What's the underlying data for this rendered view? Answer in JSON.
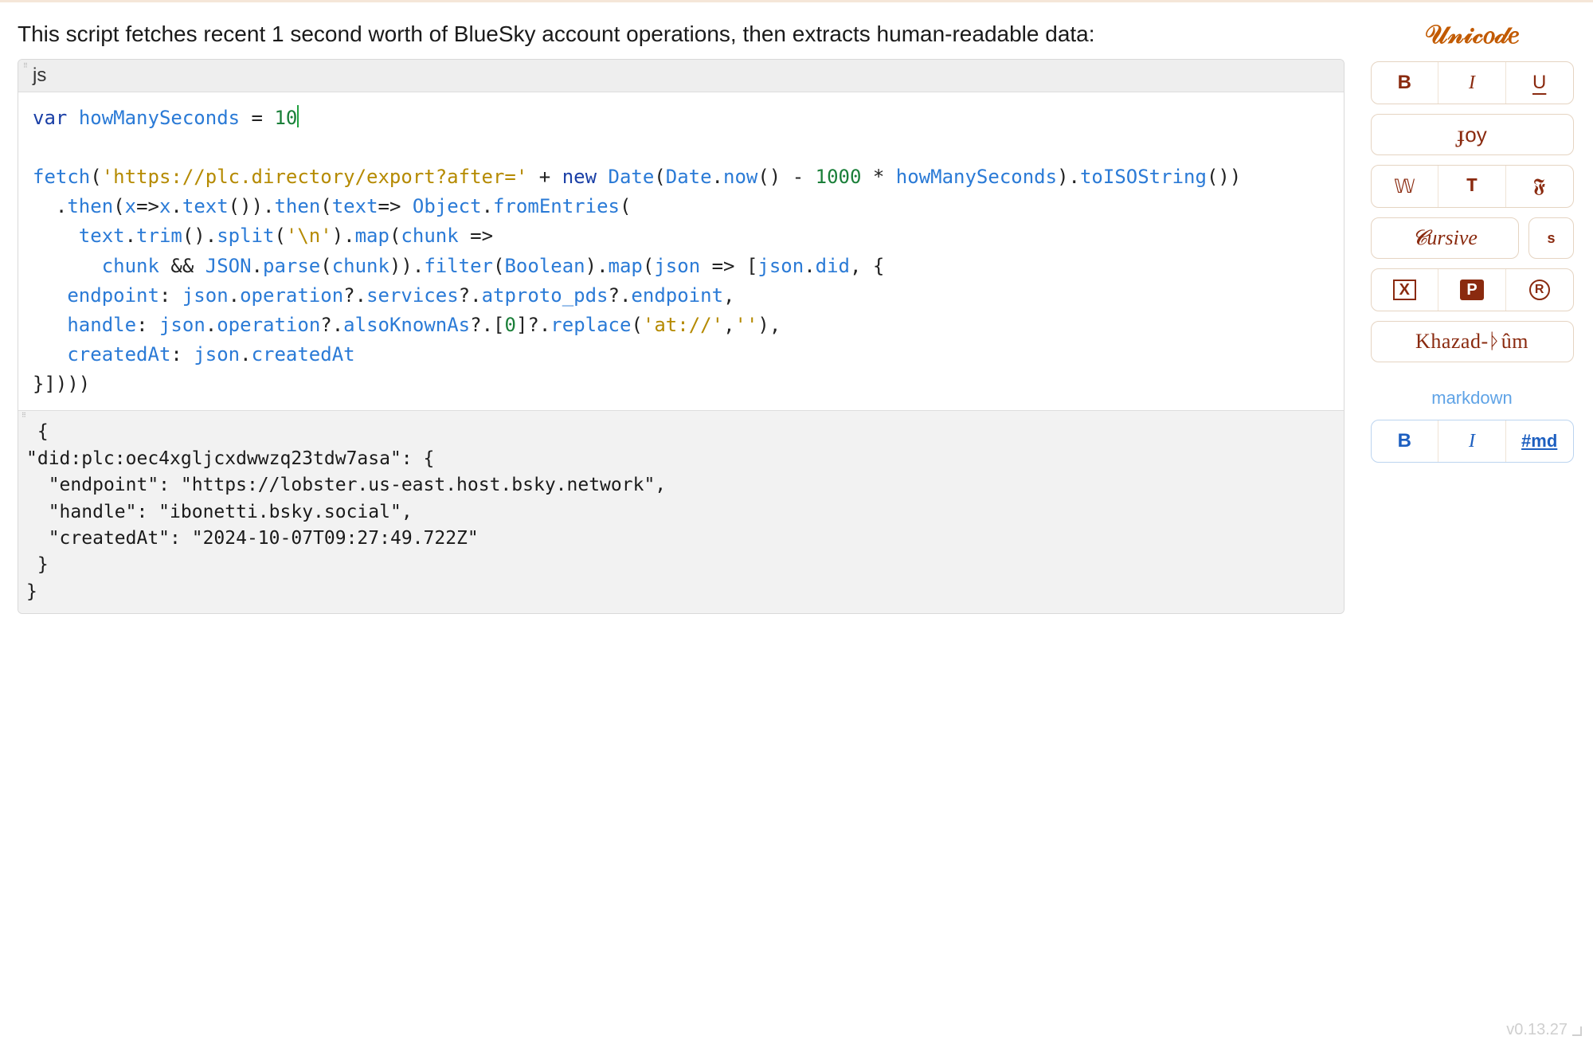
{
  "description": "This script fetches recent 1 second worth of BlueSky account operations, then extracts human-readable data:",
  "code": {
    "language_label": "js",
    "tokens": {
      "var": "var",
      "howManySeconds": "howManySeconds",
      "eq": " = ",
      "ten": "10",
      "fetch": "fetch",
      "url": "'https://plc.directory/export?after='",
      "plus": " + ",
      "new": "new",
      "Date": "Date",
      "now": "now",
      "minus1000": " - ",
      "thousand": "1000",
      "star": " * ",
      "toISOString": "toISOString",
      "then": "then",
      "x": "x",
      "text": "text",
      "Object": "Object",
      "fromEntries": "fromEntries",
      "trim": "trim",
      "split": "split",
      "nl": "'\\n'",
      "map": "map",
      "chunk": "chunk",
      "and": " && ",
      "JSON": "JSON",
      "parse": "parse",
      "filter": "filter",
      "Boolean": "Boolean",
      "json": "json",
      "did": "did",
      "endpoint": "endpoint",
      "operation": "operation",
      "services": "services",
      "atproto_pds": "atproto_pds",
      "handle": "handle",
      "alsoKnownAs": "alsoKnownAs",
      "zero": "0",
      "replace": "replace",
      "atproto_str": "'at://'",
      "empty_str": "''",
      "createdAt": "createdAt"
    }
  },
  "output_text": " {\n\"did:plc:oec4xgljcxdwwzq23tdw7asa\": {\n  \"endpoint\": \"https://lobster.us-east.host.bsky.network\",\n  \"handle\": \"ibonetti.bsky.social\",\n  \"createdAt\": \"2024-10-07T09:27:49.722Z\"\n }\n}",
  "sidebar": {
    "unicode_title": "𝒰𝓃𝒾𝒸𝑜𝒹𝑒",
    "buttons": {
      "bold": "B",
      "italic": "I",
      "underline": "U",
      "joy": "ᴊoy",
      "doublestruck": "𝕎",
      "typewriter": "T",
      "fraktur": "𝕱",
      "cursive": "𝓒ursive",
      "super": "s",
      "boxed": "X",
      "parking": "P",
      "circled": "R",
      "khazad": "Khazad-ᚦûm"
    },
    "markdown_title": "markdown",
    "md_buttons": {
      "bold": "B",
      "italic": "I",
      "heading": "#md"
    }
  },
  "version": "v0.13.27"
}
